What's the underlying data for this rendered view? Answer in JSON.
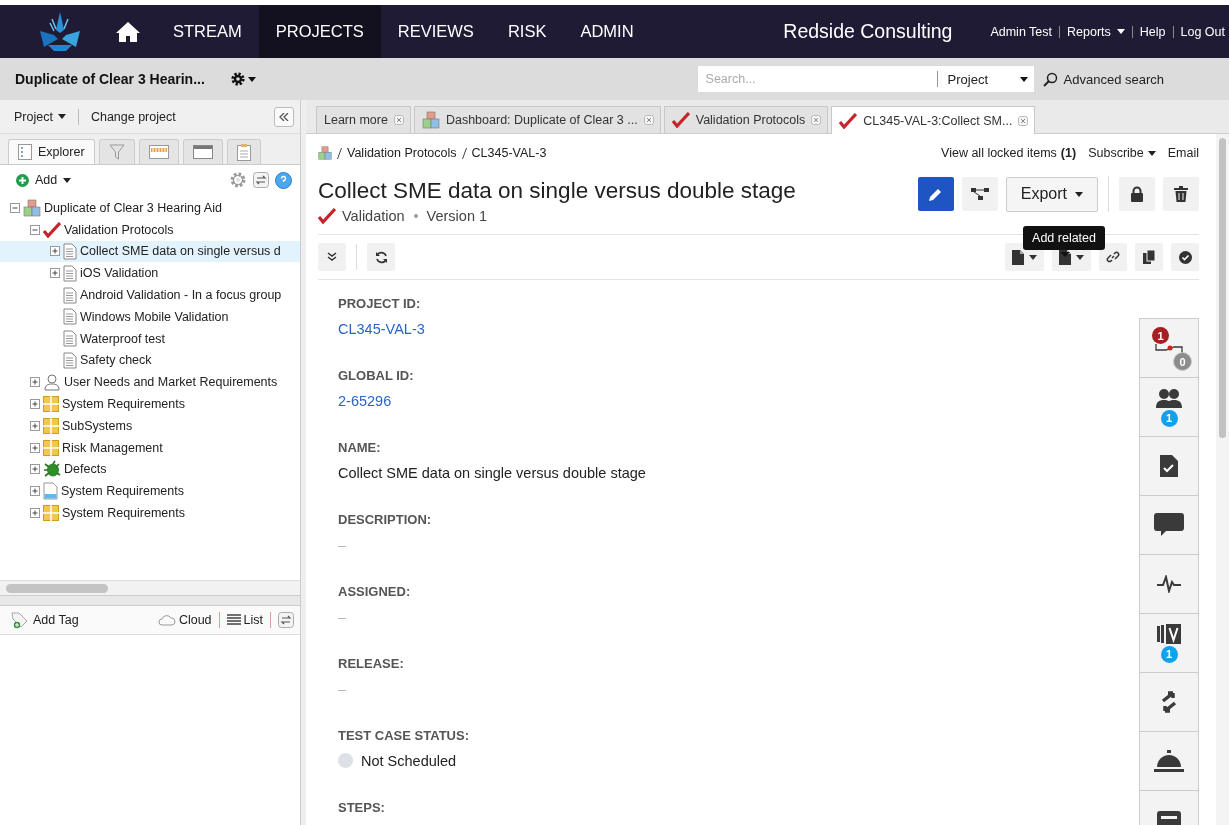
{
  "nav": {
    "items": [
      {
        "label": "STREAM",
        "selected": false
      },
      {
        "label": "PROJECTS",
        "selected": true
      },
      {
        "label": "REVIEWS",
        "selected": false
      },
      {
        "label": "RISK",
        "selected": false
      },
      {
        "label": "ADMIN",
        "selected": false
      }
    ],
    "company": "Redside Consulting",
    "user_links": [
      {
        "label": "Admin Test",
        "dropdown": false
      },
      {
        "label": "Reports",
        "dropdown": true
      },
      {
        "label": "Help",
        "dropdown": false
      },
      {
        "label": "Log Out",
        "dropdown": false
      }
    ]
  },
  "project_bar": {
    "title": "Duplicate of Clear 3 Hearin...",
    "search": {
      "placeholder": "Search...",
      "scope": "Project"
    },
    "advanced_search": "Advanced search"
  },
  "explorer": {
    "menu": "Project",
    "change_project": "Change project",
    "tabs": [
      {
        "kind": "explorer",
        "label": "Explorer",
        "selected": true
      },
      {
        "kind": "filter",
        "selected": false
      },
      {
        "kind": "timeline",
        "selected": false
      },
      {
        "kind": "window",
        "selected": false
      },
      {
        "kind": "clipboard",
        "selected": false
      }
    ],
    "add": "Add",
    "tree": [
      {
        "label": "Duplicate of Clear 3 Hearing Aid",
        "kind": "project",
        "expanded": true,
        "selected": false,
        "children": [
          {
            "label": "Validation Protocols",
            "kind": "check",
            "expanded": true,
            "selected": false,
            "children": [
              {
                "label": "Collect SME data on single versus d",
                "kind": "doc",
                "expanded": false,
                "selected": true
              },
              {
                "label": "iOS Validation",
                "kind": "doc",
                "expanded": false,
                "selected": false
              },
              {
                "label": "Android Validation - In a focus group",
                "kind": "doc",
                "selected": false
              },
              {
                "label": "Windows Mobile Validation",
                "kind": "doc",
                "selected": false
              },
              {
                "label": "Waterproof test",
                "kind": "doc",
                "selected": false
              },
              {
                "label": "Safety check",
                "kind": "doc",
                "selected": false
              }
            ]
          },
          {
            "label": "User Needs and Market Requirements",
            "kind": "user",
            "expanded": false,
            "selected": false
          },
          {
            "label": "System Requirements",
            "kind": "grid",
            "expanded": false,
            "selected": false
          },
          {
            "label": "SubSystems",
            "kind": "grid",
            "expanded": false,
            "selected": false
          },
          {
            "label": "Risk Management",
            "kind": "grid",
            "expanded": false,
            "selected": false
          },
          {
            "label": "Defects",
            "kind": "bug",
            "expanded": false,
            "selected": false
          },
          {
            "label": "System Requirements",
            "kind": "page",
            "expanded": false,
            "selected": false
          },
          {
            "label": "System Requirements",
            "kind": "grid",
            "expanded": false,
            "selected": false
          }
        ]
      }
    ],
    "tag_bar": {
      "add_tag": "Add Tag",
      "cloud": "Cloud",
      "list": "List"
    }
  },
  "doc_tabs": [
    {
      "label": "Learn more",
      "selected": false
    },
    {
      "label": "Dashboard: Duplicate of Clear 3 ...",
      "kind": "project",
      "selected": false
    },
    {
      "label": "Validation Protocols",
      "kind": "check",
      "selected": false
    },
    {
      "label": "CL345-VAL-3:Collect SM...",
      "kind": "check",
      "selected": true
    }
  ],
  "item": {
    "breadcrumb": [
      "Validation Protocols",
      "CL345-VAL-3"
    ],
    "locked": "View all locked items **(1)**",
    "subscribe": "Subscribe",
    "email": "Email",
    "title": "Collect SME data on single versus double stage",
    "type": "Validation",
    "version": "Version 1",
    "export": "Export",
    "tooltip": "Add related",
    "fields": [
      {
        "label": "PROJECT ID:",
        "kind": "link",
        "value": "CL345-VAL-3"
      },
      {
        "label": "GLOBAL ID:",
        "kind": "link",
        "value": "2-65296"
      },
      {
        "label": "NAME:",
        "kind": "text",
        "value": "Collect SME data on single versus double stage"
      },
      {
        "label": "DESCRIPTION:",
        "kind": "empty",
        "value": "–"
      },
      {
        "label": "ASSIGNED:",
        "kind": "empty",
        "value": "–"
      },
      {
        "label": "RELEASE:",
        "kind": "empty",
        "value": "–"
      },
      {
        "label": "TEST CASE STATUS:",
        "kind": "status",
        "value": "Not Scheduled",
        "color": "#dde0e6"
      },
      {
        "label": "STEPS:",
        "kind": "none"
      }
    ]
  },
  "side_panel": [
    {
      "kind": "trace",
      "badges": [
        {
          "text": "1",
          "color": "#a81c22"
        },
        {
          "text": "0",
          "color": "#8c8c8c"
        }
      ]
    },
    {
      "kind": "people",
      "badges": [
        {
          "text": "1",
          "color": "#14a0f0"
        }
      ]
    },
    {
      "kind": "doc-check"
    },
    {
      "kind": "comment"
    },
    {
      "kind": "pulse"
    },
    {
      "kind": "version",
      "badges": [
        {
          "text": "1",
          "color": "#14a0f0"
        }
      ]
    },
    {
      "kind": "swap"
    },
    {
      "kind": "bell"
    },
    {
      "kind": "card"
    }
  ]
}
